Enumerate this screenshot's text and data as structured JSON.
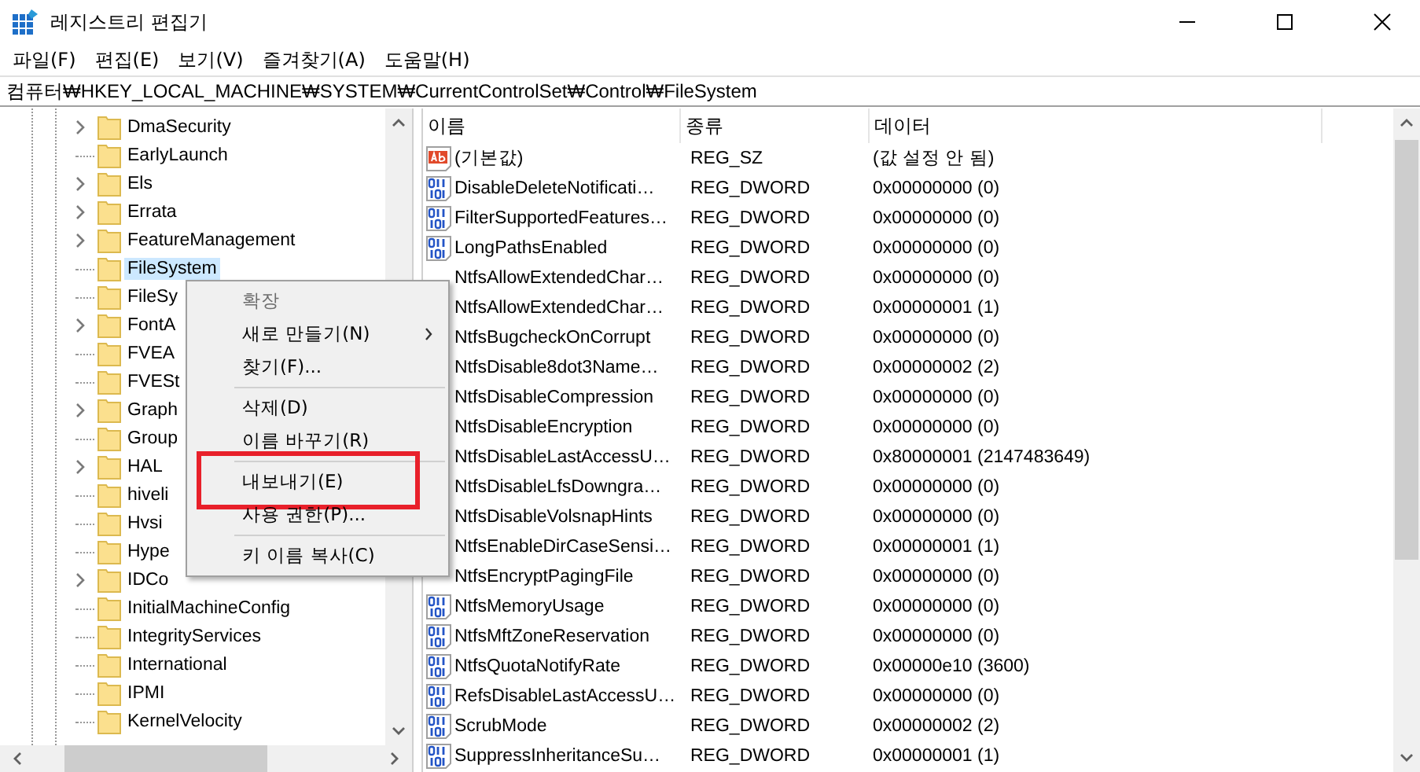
{
  "window": {
    "title": "레지스트리 편집기"
  },
  "menu_bar": [
    "파일(F)",
    "편집(E)",
    "보기(V)",
    "즐겨찾기(A)",
    "도움말(H)"
  ],
  "address": "컴퓨터₩HKEY_LOCAL_MACHINE₩SYSTEM₩CurrentControlSet₩Control₩FileSystem",
  "tree": [
    {
      "label": "DmaSecurity",
      "expandable": true,
      "selected": false
    },
    {
      "label": "EarlyLaunch",
      "expandable": false,
      "selected": false
    },
    {
      "label": "Els",
      "expandable": true,
      "selected": false
    },
    {
      "label": "Errata",
      "expandable": true,
      "selected": false
    },
    {
      "label": "FeatureManagement",
      "expandable": true,
      "selected": false
    },
    {
      "label": "FileSystem",
      "expandable": false,
      "selected": true
    },
    {
      "label": "FileSy",
      "expandable": false,
      "selected": false
    },
    {
      "label": "FontA",
      "expandable": true,
      "selected": false
    },
    {
      "label": "FVEA",
      "expandable": false,
      "selected": false
    },
    {
      "label": "FVESt",
      "expandable": false,
      "selected": false
    },
    {
      "label": "Graph",
      "expandable": true,
      "selected": false
    },
    {
      "label": "Group",
      "expandable": false,
      "selected": false
    },
    {
      "label": "HAL",
      "expandable": true,
      "selected": false
    },
    {
      "label": "hiveli",
      "expandable": false,
      "selected": false
    },
    {
      "label": "Hvsi",
      "expandable": false,
      "selected": false
    },
    {
      "label": "Hype",
      "expandable": false,
      "selected": false
    },
    {
      "label": "IDCo",
      "expandable": true,
      "selected": false
    },
    {
      "label": "InitialMachineConfig",
      "expandable": false,
      "selected": false
    },
    {
      "label": "IntegrityServices",
      "expandable": false,
      "selected": false
    },
    {
      "label": "International",
      "expandable": false,
      "selected": false
    },
    {
      "label": "IPMI",
      "expandable": false,
      "selected": false
    },
    {
      "label": "KernelVelocity",
      "expandable": false,
      "selected": false
    }
  ],
  "list": {
    "columns": [
      "이름",
      "종류",
      "데이터"
    ],
    "rows": [
      {
        "kind": "string",
        "name": "(기본값)",
        "type": "REG_SZ",
        "data": "(값 설정 안 됨)"
      },
      {
        "kind": "dword",
        "name": "DisableDeleteNotificati…",
        "type": "REG_DWORD",
        "data": "0x00000000 (0)"
      },
      {
        "kind": "dword",
        "name": "FilterSupportedFeatures…",
        "type": "REG_DWORD",
        "data": "0x00000000 (0)"
      },
      {
        "kind": "dword",
        "name": "LongPathsEnabled",
        "type": "REG_DWORD",
        "data": "0x00000000 (0)"
      },
      {
        "name": "NtfsAllowExtendedChar…",
        "type": "REG_DWORD",
        "data": "0x00000000 (0)"
      },
      {
        "name": "NtfsAllowExtendedChar…",
        "type": "REG_DWORD",
        "data": "0x00000001 (1)"
      },
      {
        "name": "NtfsBugcheckOnCorrupt",
        "type": "REG_DWORD",
        "data": "0x00000000 (0)"
      },
      {
        "name": "NtfsDisable8dot3Name…",
        "type": "REG_DWORD",
        "data": "0x00000002 (2)"
      },
      {
        "name": "NtfsDisableCompression",
        "type": "REG_DWORD",
        "data": "0x00000000 (0)"
      },
      {
        "name": "NtfsDisableEncryption",
        "type": "REG_DWORD",
        "data": "0x00000000 (0)"
      },
      {
        "name": "NtfsDisableLastAccessU…",
        "type": "REG_DWORD",
        "data": "0x80000001 (2147483649)"
      },
      {
        "name": "NtfsDisableLfsDowngra…",
        "type": "REG_DWORD",
        "data": "0x00000000 (0)"
      },
      {
        "name": "NtfsDisableVolsnapHints",
        "type": "REG_DWORD",
        "data": "0x00000000 (0)"
      },
      {
        "name": "NtfsEnableDirCaseSensi…",
        "type": "REG_DWORD",
        "data": "0x00000001 (1)"
      },
      {
        "name": "NtfsEncryptPagingFile",
        "type": "REG_DWORD",
        "data": "0x00000000 (0)"
      },
      {
        "kind": "dword",
        "name": "NtfsMemoryUsage",
        "type": "REG_DWORD",
        "data": "0x00000000 (0)"
      },
      {
        "kind": "dword",
        "name": "NtfsMftZoneReservation",
        "type": "REG_DWORD",
        "data": "0x00000000 (0)"
      },
      {
        "kind": "dword",
        "name": "NtfsQuotaNotifyRate",
        "type": "REG_DWORD",
        "data": "0x00000e10 (3600)"
      },
      {
        "kind": "dword",
        "name": "RefsDisableLastAccessU…",
        "type": "REG_DWORD",
        "data": "0x00000000 (0)"
      },
      {
        "kind": "dword",
        "name": "ScrubMode",
        "type": "REG_DWORD",
        "data": "0x00000002 (2)"
      },
      {
        "kind": "dword",
        "name": "SuppressInheritanceSu…",
        "type": "REG_DWORD",
        "data": "0x00000001 (1)"
      }
    ]
  },
  "context_menu": {
    "items": [
      {
        "kind": "item",
        "label": "확장",
        "disabled": true,
        "submenu": false,
        "highlighted": false
      },
      {
        "kind": "item",
        "label": "새로 만들기(N)",
        "disabled": false,
        "submenu": true,
        "highlighted": false
      },
      {
        "kind": "item",
        "label": "찾기(F)...",
        "disabled": false,
        "submenu": false,
        "highlighted": false
      },
      {
        "kind": "separator"
      },
      {
        "kind": "item",
        "label": "삭제(D)",
        "disabled": false,
        "submenu": false,
        "highlighted": false
      },
      {
        "kind": "item",
        "label": "이름 바꾸기(R)",
        "disabled": false,
        "submenu": false,
        "highlighted": false
      },
      {
        "kind": "separator"
      },
      {
        "kind": "item",
        "label": "내보내기(E)",
        "disabled": false,
        "submenu": false,
        "highlighted": true
      },
      {
        "kind": "item",
        "label": "사용 권한(P)...",
        "disabled": false,
        "submenu": false,
        "highlighted": false
      },
      {
        "kind": "separator"
      },
      {
        "kind": "item",
        "label": "키 이름 복사(C)",
        "disabled": false,
        "submenu": false,
        "highlighted": false
      }
    ]
  }
}
